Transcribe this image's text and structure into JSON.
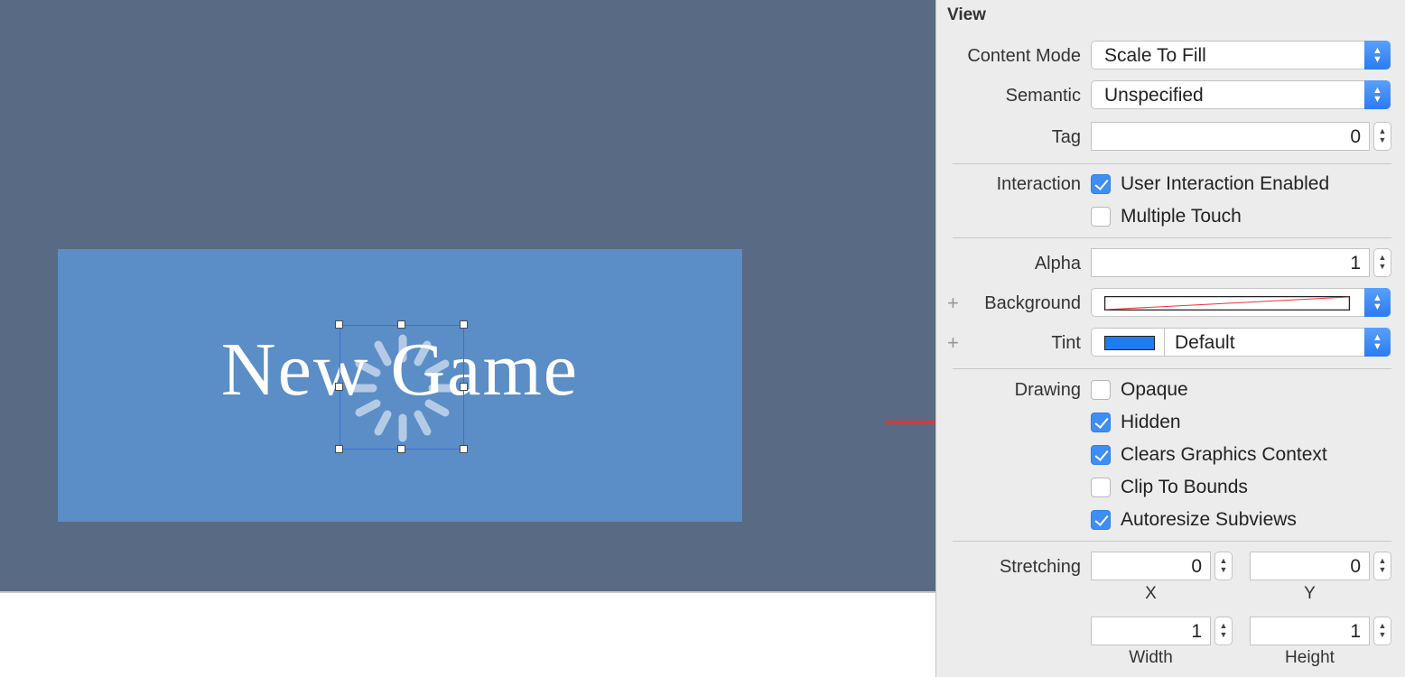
{
  "canvas": {
    "button_title": "New Game",
    "selection_color": "#3a6fe0"
  },
  "inspector": {
    "section_title": "View",
    "content_mode": {
      "label": "Content Mode",
      "value": "Scale To Fill"
    },
    "semantic": {
      "label": "Semantic",
      "value": "Unspecified"
    },
    "tag": {
      "label": "Tag",
      "value": "0"
    },
    "interaction": {
      "label": "Interaction",
      "options": [
        {
          "label": "User Interaction Enabled",
          "checked": true
        },
        {
          "label": "Multiple Touch",
          "checked": false
        }
      ]
    },
    "alpha": {
      "label": "Alpha",
      "value": "1"
    },
    "background": {
      "label": "Background"
    },
    "tint": {
      "label": "Tint",
      "value": "Default",
      "swatch": "#1e7cf0"
    },
    "drawing": {
      "label": "Drawing",
      "options": [
        {
          "label": "Opaque",
          "checked": false
        },
        {
          "label": "Hidden",
          "checked": true
        },
        {
          "label": "Clears Graphics Context",
          "checked": true
        },
        {
          "label": "Clip To Bounds",
          "checked": false
        },
        {
          "label": "Autoresize Subviews",
          "checked": true
        }
      ]
    },
    "stretching": {
      "label": "Stretching",
      "x": {
        "value": "0",
        "label": "X"
      },
      "y": {
        "value": "0",
        "label": "Y"
      },
      "width": {
        "value": "1",
        "label": "Width"
      },
      "height": {
        "value": "1",
        "label": "Height"
      }
    }
  },
  "annotation": {
    "arrow_color": "#e8332a"
  }
}
